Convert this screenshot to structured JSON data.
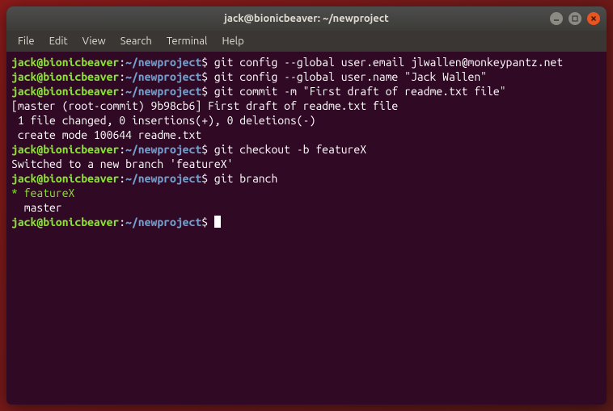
{
  "titlebar": {
    "title": "jack@bionicbeaver: ~/newproject"
  },
  "menubar": {
    "items": [
      "File",
      "Edit",
      "View",
      "Search",
      "Terminal",
      "Help"
    ]
  },
  "prompt": {
    "user_host": "jack@bionicbeaver",
    "separator": ":",
    "path": "~/newproject",
    "symbol": "$"
  },
  "lines": [
    {
      "type": "prompt",
      "cmd": "git config --global user.email jlwallen@monkeypantz.net"
    },
    {
      "type": "prompt",
      "cmd": "git config --global user.name \"Jack Wallen\""
    },
    {
      "type": "prompt",
      "cmd": "git commit -m \"First draft of readme.txt file\""
    },
    {
      "type": "output",
      "text": "[master (root-commit) 9b98cb6] First draft of readme.txt file"
    },
    {
      "type": "output",
      "text": " 1 file changed, 0 insertions(+), 0 deletions(-)"
    },
    {
      "type": "output",
      "text": " create mode 100644 readme.txt"
    },
    {
      "type": "prompt",
      "cmd": "git checkout -b featureX"
    },
    {
      "type": "output",
      "text": "Switched to a new branch 'featureX'"
    },
    {
      "type": "prompt",
      "cmd": "git branch"
    },
    {
      "type": "branch-current",
      "text": "* featureX"
    },
    {
      "type": "output",
      "text": "  master"
    },
    {
      "type": "prompt-cursor",
      "cmd": ""
    }
  ]
}
